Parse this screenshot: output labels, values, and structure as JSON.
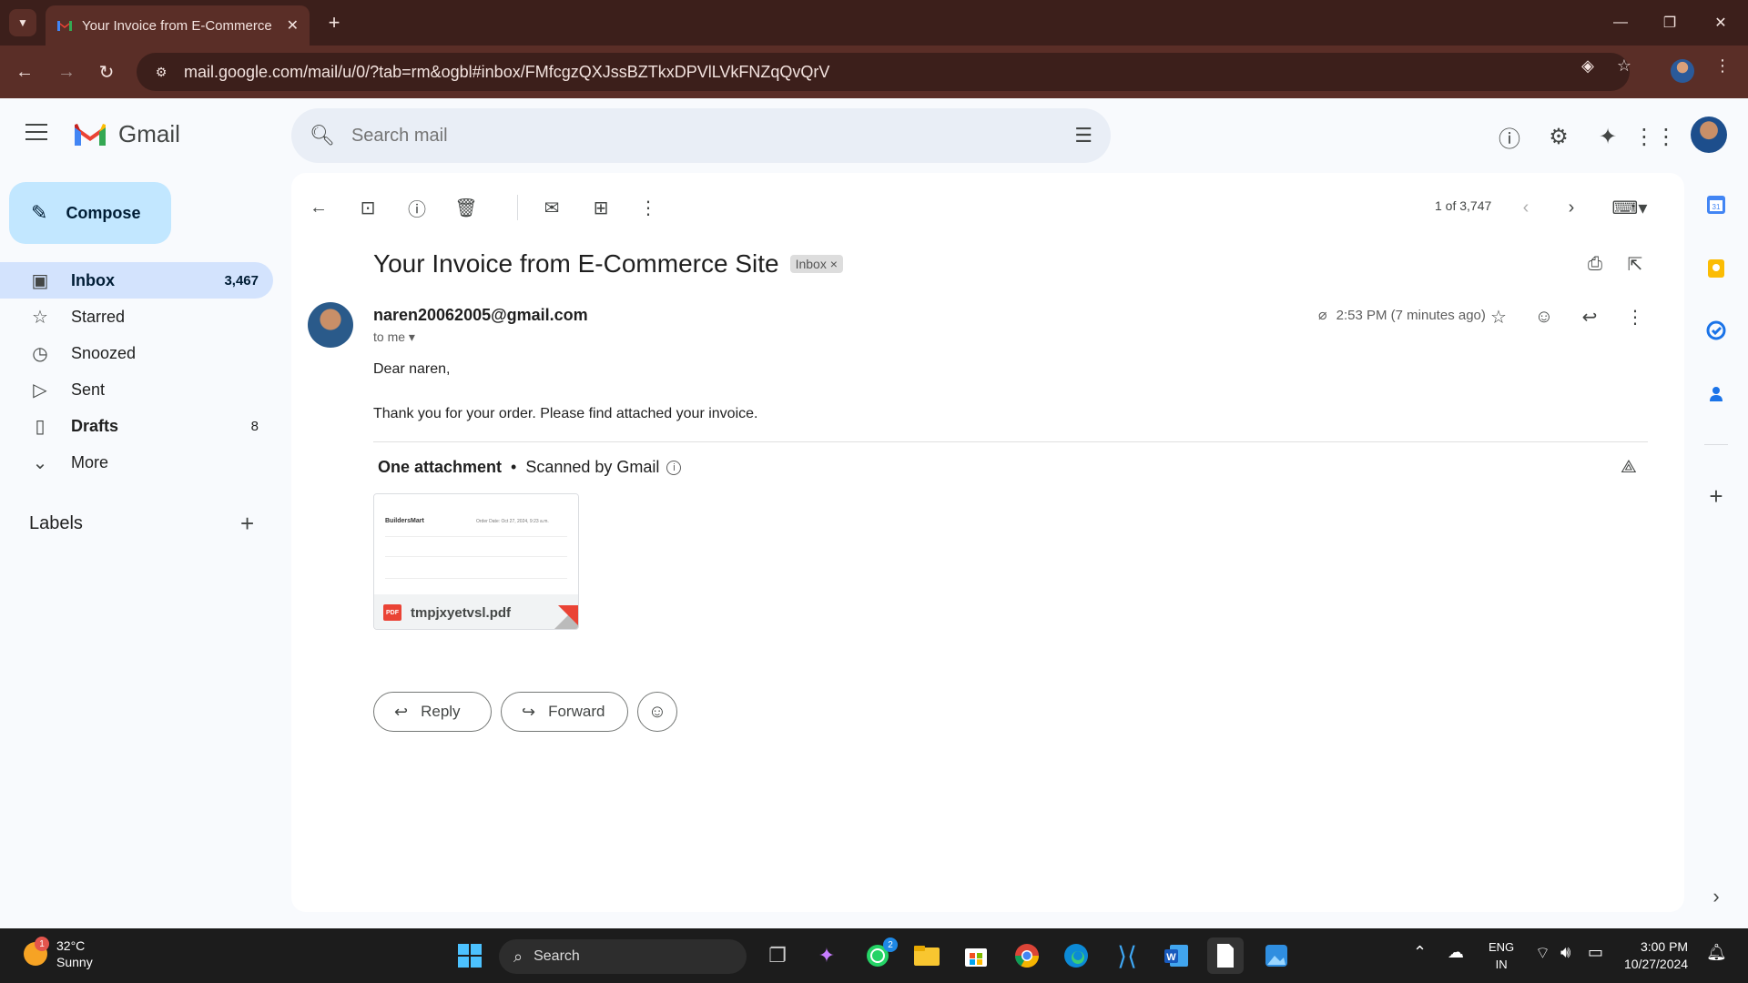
{
  "browser": {
    "tab_title": "Your Invoice from E-Commerce",
    "url": "mail.google.com/mail/u/0/?tab=rm&ogbl#inbox/FMfcgzQXJssBZTkxDPVlLVkFNZqQvQrV"
  },
  "gmail": {
    "logo_text": "Gmail",
    "search_placeholder": "Search mail",
    "compose_label": "Compose",
    "nav": [
      {
        "label": "Inbox",
        "count": "3,467"
      },
      {
        "label": "Starred",
        "count": ""
      },
      {
        "label": "Snoozed",
        "count": ""
      },
      {
        "label": "Sent",
        "count": ""
      },
      {
        "label": "Drafts",
        "count": "8"
      },
      {
        "label": "More",
        "count": ""
      }
    ],
    "labels_heading": "Labels"
  },
  "message": {
    "pager": "1 of 3,747",
    "subject": "Your Invoice from E-Commerce Site",
    "label_chip": "Inbox",
    "sender": "naren20062005@gmail.com",
    "to": "to me",
    "time": "2:53 PM (7 minutes ago)",
    "greeting": "Dear naren,",
    "body": "Thank you for your order. Please find attached your invoice.",
    "attachment_heading": "One attachment",
    "scanned": "Scanned by Gmail",
    "attachment": {
      "filename": "tmpjxyetvsl.pdf",
      "thumb_title": "BuildersMart",
      "thumb_order": "Order Date: Oct 27, 2024, 9:23 a.m."
    },
    "reply_label": "Reply",
    "forward_label": "Forward"
  },
  "taskbar": {
    "weather_temp": "32°C",
    "weather_desc": "Sunny",
    "weather_badge": "1",
    "search_label": "Search",
    "whatsapp_badge": "2",
    "lang_line1": "ENG",
    "lang_line2": "IN",
    "time": "3:00 PM",
    "date": "10/27/2024"
  },
  "colors": {
    "chrome_frame": "#3c1f1b",
    "chrome_toolbar": "#5a2e27",
    "compose_bg": "#c2e7ff",
    "inbox_active": "#d3e3fd",
    "gmail_red": "#ea4335"
  }
}
